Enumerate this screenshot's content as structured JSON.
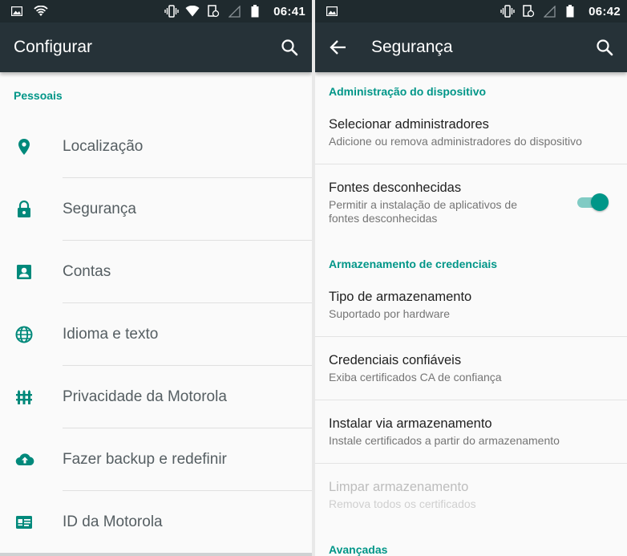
{
  "left": {
    "status": {
      "time": "06:41"
    },
    "appbar": {
      "title": "Configurar"
    },
    "section": "Pessoais",
    "items": [
      {
        "label": "Localização",
        "icon": "location-pin-icon"
      },
      {
        "label": "Segurança",
        "icon": "lock-icon"
      },
      {
        "label": "Contas",
        "icon": "account-box-icon"
      },
      {
        "label": "Idioma e texto",
        "icon": "globe-icon"
      },
      {
        "label": "Privacidade da Motorola",
        "icon": "fence-icon"
      },
      {
        "label": "Fazer backup e redefinir",
        "icon": "cloud-upload-icon"
      },
      {
        "label": "ID da Motorola",
        "icon": "id-card-icon"
      }
    ]
  },
  "right": {
    "status": {
      "time": "06:42"
    },
    "appbar": {
      "title": "Segurança"
    },
    "sections": {
      "admin": "Administração do dispositivo",
      "credentials": "Armazenamento de credenciais",
      "advanced": "Avançadas"
    },
    "items": {
      "select_admins": {
        "title": "Selecionar administradores",
        "subtitle": "Adicione ou remova administradores do dispositivo"
      },
      "unknown_sources": {
        "title": "Fontes desconhecidas",
        "subtitle_line1": "Permitir a instalação de aplicativos de",
        "subtitle_line2": "fontes desconhecidas",
        "enabled": true
      },
      "storage_type": {
        "title": "Tipo de armazenamento",
        "subtitle": "Suportado por hardware"
      },
      "trusted_credentials": {
        "title": "Credenciais confiáveis",
        "subtitle": "Exiba certificados CA de confiança"
      },
      "install_storage": {
        "title": "Instalar via armazenamento",
        "subtitle": "Instale certificados a partir do armazenamento"
      },
      "clear_storage": {
        "title": "Limpar armazenamento",
        "subtitle": "Remova todos os certificados",
        "disabled": true
      }
    }
  },
  "colors": {
    "accent": "#009688",
    "appbar": "#263238",
    "statusbar": "#1f2a2e"
  }
}
